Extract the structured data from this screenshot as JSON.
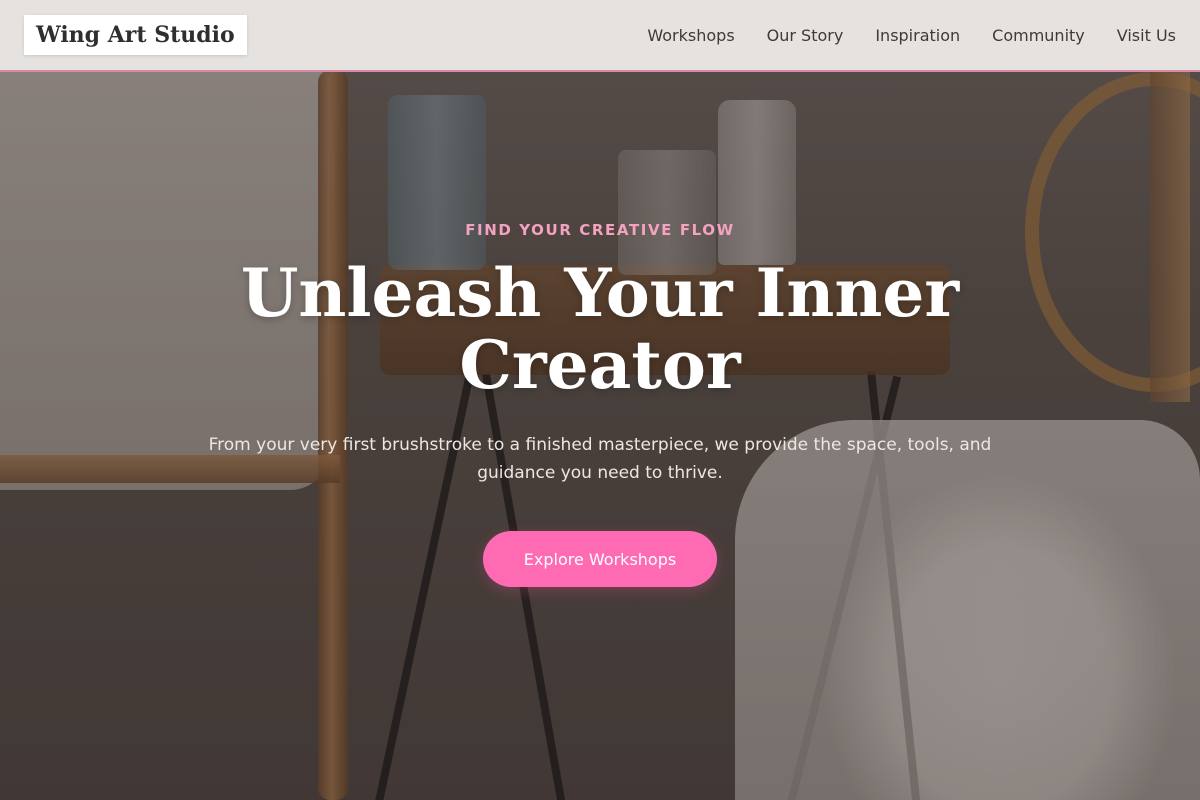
{
  "header": {
    "logo": "Wing Art Studio",
    "nav": [
      {
        "label": "Workshops"
      },
      {
        "label": "Our Story"
      },
      {
        "label": "Inspiration"
      },
      {
        "label": "Community"
      },
      {
        "label": "Visit Us"
      }
    ]
  },
  "hero": {
    "eyebrow": "FIND YOUR CREATIVE FLOW",
    "title": "Unleash Your Inner Creator",
    "subtitle": "From your very first brushstroke to a finished masterpiece, we provide the space, tools, and guidance you need to thrive.",
    "cta_label": "Explore Workshops"
  },
  "colors": {
    "accent": "#ff6bb3",
    "eyebrow": "#f3a2bf",
    "header_border": "#d98aa8"
  }
}
